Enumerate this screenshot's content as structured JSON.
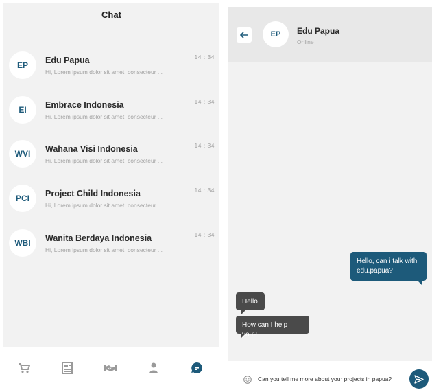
{
  "chat_list": {
    "title": "Chat",
    "items": [
      {
        "initials": "EP",
        "name": "Edu Papua",
        "preview": "Hi, Lorem ipsum dolor sit amet, consecteur ...",
        "time": "14 : 34"
      },
      {
        "initials": "EI",
        "name": "Embrace Indonesia",
        "preview": "Hi, Lorem ipsum dolor sit amet, consecteur ...",
        "time": "14 : 34"
      },
      {
        "initials": "WVI",
        "name": "Wahana Visi Indonesia",
        "preview": "Hi, Lorem ipsum dolor sit amet, consecteur ...",
        "time": "14 : 34"
      },
      {
        "initials": "PCI",
        "name": "Project Child Indonesia",
        "preview": "Hi, Lorem ipsum dolor sit amet, consecteur ...",
        "time": "14 : 34"
      },
      {
        "initials": "WBI",
        "name": "Wanita Berdaya Indonesia",
        "preview": "Hi, Lorem ipsum dolor sit amet, consecteur ...",
        "time": "14 : 34"
      }
    ]
  },
  "bottom_nav": {
    "items": [
      {
        "icon": "cart-icon",
        "active": false
      },
      {
        "icon": "document-icon",
        "active": false
      },
      {
        "icon": "handshake-icon",
        "active": false
      },
      {
        "icon": "person-icon",
        "active": false
      },
      {
        "icon": "chat-bubble-icon",
        "active": true
      }
    ]
  },
  "conversation": {
    "contact_initials": "EP",
    "contact_name": "Edu Papua",
    "contact_status": "Online",
    "messages": [
      {
        "direction": "outgoing",
        "text": "Hello, can i talk with edu.papua?"
      },
      {
        "direction": "incoming",
        "text": "Hello"
      },
      {
        "direction": "incoming",
        "text": "How can I help you?"
      }
    ],
    "input_value": "Can you tell me more about your projects in papua?"
  },
  "colors": {
    "accent": "#1d5a7a",
    "incoming_bubble": "#4a4a4a",
    "panel_bg": "#f2f2f2",
    "header_bg": "#e8e8e8",
    "muted_text": "#a3a3a3",
    "nav_icon": "#9a9a9a"
  }
}
